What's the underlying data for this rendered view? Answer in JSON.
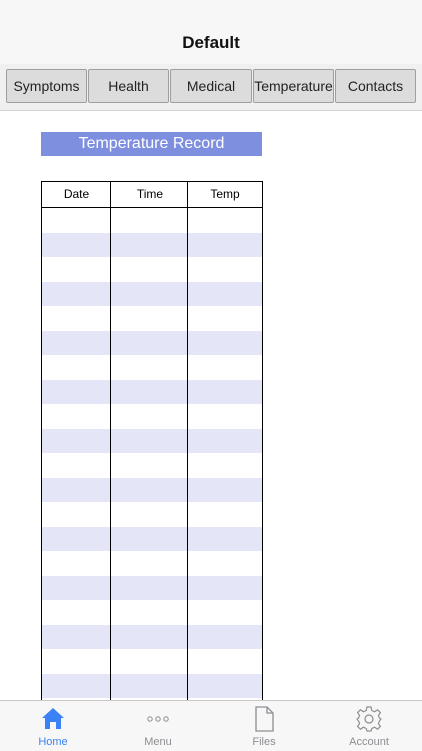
{
  "nav": {
    "title": "Default"
  },
  "tabs": [
    {
      "label": "Symptoms"
    },
    {
      "label": "Health"
    },
    {
      "label": "Medical"
    },
    {
      "label": "Temperature"
    },
    {
      "label": "Contacts"
    }
  ],
  "record": {
    "title": "Temperature Record",
    "columns": [
      "Date",
      "Time",
      "Temp"
    ],
    "row_count": 20
  },
  "tabbar": {
    "items": [
      {
        "label": "Home",
        "icon": "home-icon",
        "active": true
      },
      {
        "label": "Menu",
        "icon": "ellipsis-icon",
        "active": false
      },
      {
        "label": "Files",
        "icon": "file-icon",
        "active": false
      },
      {
        "label": "Account",
        "icon": "gear-icon",
        "active": false
      }
    ]
  },
  "colors": {
    "accent": "#3b82f6",
    "record_header": "#7f8fe0",
    "row_alt": "#e4e6f8"
  }
}
